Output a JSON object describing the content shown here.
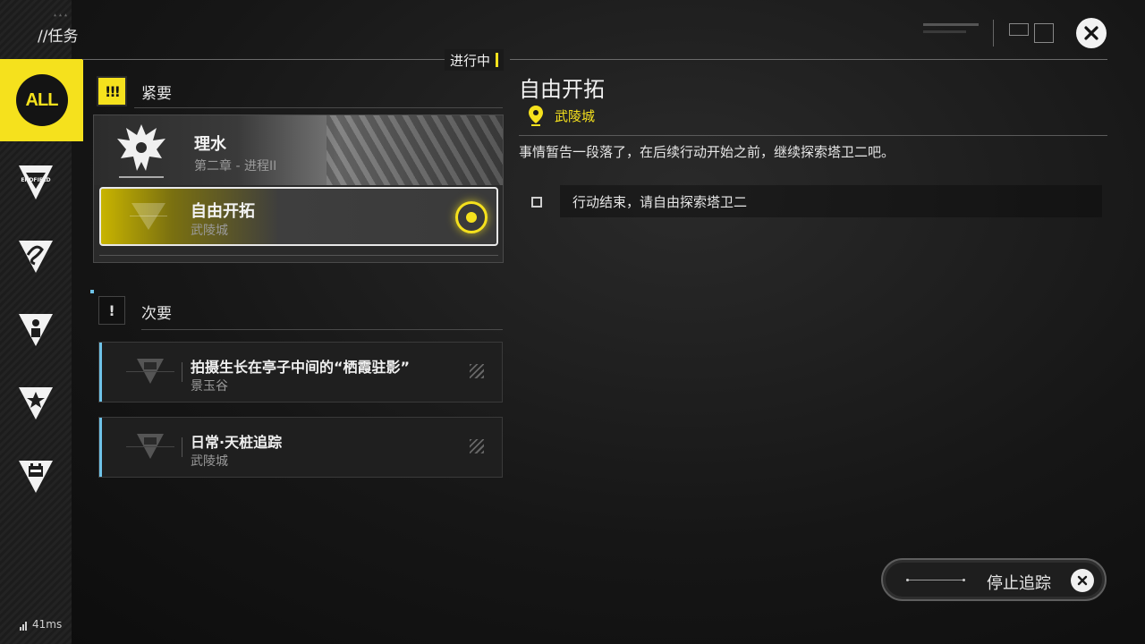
{
  "header": {
    "title": "//任务",
    "status_tag": "进行中"
  },
  "sidebar": {
    "items": [
      {
        "label": "ALL",
        "icon": "all-icon",
        "active": true
      },
      {
        "label": "ENDFIELD",
        "icon": "endfield-icon"
      },
      {
        "label": "",
        "icon": "swirl-icon"
      },
      {
        "label": "",
        "icon": "person-icon"
      },
      {
        "label": "",
        "icon": "star-icon"
      },
      {
        "label": "",
        "icon": "calendar-icon"
      }
    ]
  },
  "urgent": {
    "label": "紧要",
    "icon_text": "!!!",
    "quests": [
      {
        "title": "理水",
        "subtitle": "第二章 - 进程II"
      },
      {
        "title": "自由开拓",
        "subtitle": "武陵城",
        "tracked": true
      }
    ]
  },
  "secondary": {
    "label": "次要",
    "icon_text": "!",
    "quests": [
      {
        "title": "拍摄生长在亭子中间的“栖霞驻影”",
        "subtitle": "景玉谷"
      },
      {
        "title": "日常·天桩追踪",
        "subtitle": "武陵城"
      }
    ]
  },
  "detail": {
    "title": "自由开拓",
    "location": "武陵城",
    "description": "事情暂告一段落了，在后续行动开始之前，继续探索塔卫二吧。",
    "objective": "行动结束，请自由探索塔卫二"
  },
  "stop_button": {
    "label": "停止追踪"
  },
  "ping": {
    "value": "41ms"
  },
  "colors": {
    "accent": "#f5e11d",
    "secondary_bar": "#6fc3e8"
  }
}
